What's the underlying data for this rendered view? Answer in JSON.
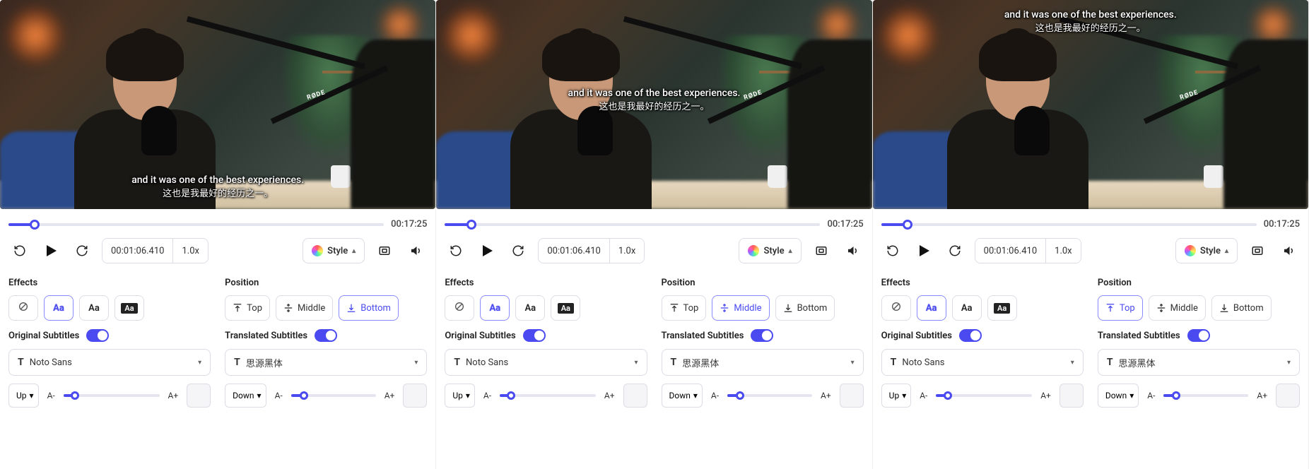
{
  "panels": [
    {
      "position_selected": "bottom",
      "subtitle_pos_class": "pos-bottom"
    },
    {
      "position_selected": "middle",
      "subtitle_pos_class": "pos-middle"
    },
    {
      "position_selected": "top",
      "subtitle_pos_class": "pos-top"
    }
  ],
  "video": {
    "rode_label": "RØDE",
    "subtitle_en": "and it was one of the best experiences.",
    "subtitle_zh": "这也是我最好的经历之一。",
    "duration": "00:17:25",
    "timecode": "00:01:06.410",
    "speed": "1.0x",
    "progress_pct": "7%"
  },
  "controls": {
    "style_label": "Style"
  },
  "effects": {
    "label": "Effects",
    "sample_outline": "Aa",
    "sample_plain": "Aa",
    "sample_box": "Aa"
  },
  "position": {
    "label": "Position",
    "top": "Top",
    "middle": "Middle",
    "bottom": "Bottom"
  },
  "original": {
    "label": "Original Subtitles",
    "font": "Noto Sans",
    "dir": "Up",
    "a_minus": "A-",
    "a_plus": "A+",
    "slider_pct": "12%"
  },
  "translated": {
    "label": "Translated Subtitles",
    "font": "思源黑体",
    "dir": "Down",
    "a_minus": "A-",
    "a_plus": "A+",
    "slider_pct": "15%"
  }
}
